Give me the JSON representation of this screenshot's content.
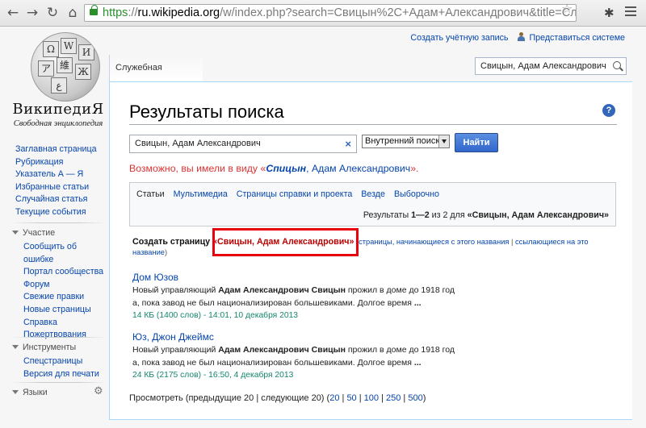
{
  "browser": {
    "url_scheme": "https",
    "url_sep": "://",
    "url_host": "ru.wikipedia.org",
    "url_path": "/w/index.php?search=Свицын%2С+Адам+Александрович&title=Служе",
    "back_icon": "arrow-left-icon",
    "forward_icon": "arrow-right-icon",
    "reload_icon": "reload-icon",
    "home_icon": "home-icon"
  },
  "logo": {
    "title": "ВикипедиЯ",
    "tagline": "Свободная энциклопедия",
    "pieces": [
      "Ω",
      "W",
      "И",
      "ア",
      "維",
      "Ж",
      "ع"
    ]
  },
  "personal": {
    "create_account": "Создать учётную запись",
    "login": "Представиться системе"
  },
  "tab": {
    "special_page": "Служебная страница"
  },
  "header_search": {
    "value": "Свицын, Адам Александрович"
  },
  "sidebar": {
    "main": [
      "Заглавная страница",
      "Рубрикация",
      "Указатель А — Я",
      "Избранные статьи",
      "Случайная статья",
      "Текущие события"
    ],
    "participation": {
      "heading": "Участие",
      "items": [
        "Сообщить об ошибке",
        "Портал сообщества",
        "Форум",
        "Свежие правки",
        "Новые страницы",
        "Справка",
        "Пожертвования"
      ]
    },
    "tools": {
      "heading": "Инструменты",
      "items": [
        "Спецстраницы",
        "Версия для печати"
      ]
    },
    "languages": {
      "heading": "Языки"
    }
  },
  "content": {
    "title": "Результаты поиска",
    "search": {
      "value": "Свицын, Адам Александрович",
      "profile": "Внутренний поиск",
      "button": "Найти"
    },
    "did_you_mean": {
      "prefix": "Возможно, вы имели в виду «",
      "suggestion_bold": "Спицын",
      "suggestion_rest": ", Адам Александрович",
      "suffix": "»."
    },
    "tabs": [
      "Статьи",
      "Мультимедиа",
      "Страницы справки и проекта",
      "Везде",
      "Выборочно"
    ],
    "results_info": {
      "prefix": "Результаты ",
      "range": "1—2",
      "middle": " из ",
      "total": "2",
      "for_label": " для ",
      "query": "«Свицын, Адам Александрович»"
    },
    "create": {
      "lead": "Создать страницу ",
      "new_page": "«Свицын, Адам Александрович»",
      "open_paren": " (",
      "starting_with": "страницы, начинающиеся с этого названия",
      "separator": " | ",
      "links_here_line1": "ссылающиеся на это",
      "links_here_line2": "название",
      "close_paren": ")"
    },
    "results": [
      {
        "title": "Дом Юзов",
        "line1_pre": "Новый управляющий ",
        "line1_bold": "Адам Александрович Свицын",
        "line1_post": " прожил в доме до 1918 год",
        "line2": "а, пока завод не был национализирован большевиками. Долгое время ",
        "line2_bold": "...",
        "meta": "14 КБ (1400 слов) - 14:01, 10 декабря 2013"
      },
      {
        "title": "Юз, Джон Джеймс",
        "line1_pre": "Новый управляющий ",
        "line1_bold": "Адам Александрович Свицын",
        "line1_post": " прожил в доме до 1918 год",
        "line2": "а, пока завод не был национализирован большевиками. Долгое время ",
        "line2_bold": "...",
        "meta": "24 КБ (2175 слов) - 16:50, 4 декабря 2013"
      }
    ],
    "pager": {
      "prefix": "Просмотреть (предыдущие 20 | следующие 20) (",
      "sizes": [
        "20",
        "50",
        "100",
        "250",
        "500"
      ],
      "sep": " | ",
      "suffix": ")"
    }
  }
}
